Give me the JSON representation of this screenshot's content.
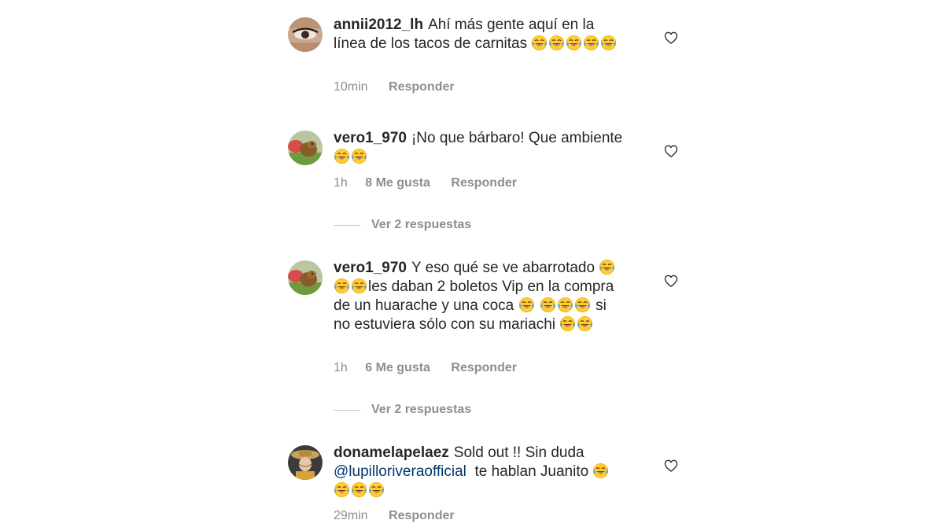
{
  "comments": [
    {
      "username": "annii2012_lh",
      "text": "Ahí más gente aquí en la línea de los tacos de carnitas",
      "emoji_after": 5,
      "time": "10min",
      "likes": "",
      "reply_label": "Responder",
      "avatar_icon": "avatar-eye-photo"
    },
    {
      "username": "vero1_970",
      "text": "¡No que bárbaro! Que ambiente",
      "emoji_after": 2,
      "time": "1h",
      "likes": "8 Me gusta",
      "reply_label": "Responder",
      "avatar_icon": "avatar-dog-photo",
      "view_replies": "Ver 2 respuestas"
    },
    {
      "username": "vero1_970",
      "text_1": "Y eso qué se ve abarrotado",
      "text_2": "les daban 2 boletos Vip en la compra de un huarache y una coca",
      "text_3": "si  no estuviera sólo con su mariachi",
      "time": "1h",
      "likes": "6 Me gusta",
      "reply_label": "Responder",
      "avatar_icon": "avatar-dog-photo",
      "view_replies": "Ver 2 respuestas"
    },
    {
      "username": "donamelapelaez",
      "text_1": "Sold out !! Sin duda",
      "mention": "@lupilloriveraofficial",
      "text_2": "te hablan Juanito",
      "time": "29min",
      "likes": "",
      "reply_label": "Responder",
      "avatar_icon": "avatar-woman-hat-photo"
    }
  ],
  "icons": {
    "emoji": "face-with-tears-of-joy-icon",
    "like": "heart-outline-icon"
  },
  "colors": {
    "text": "#262626",
    "secondary": "#8e8e8e",
    "mention": "#00376b",
    "emoji_face": "#ffcc33",
    "emoji_tear": "#4fa8e8"
  }
}
